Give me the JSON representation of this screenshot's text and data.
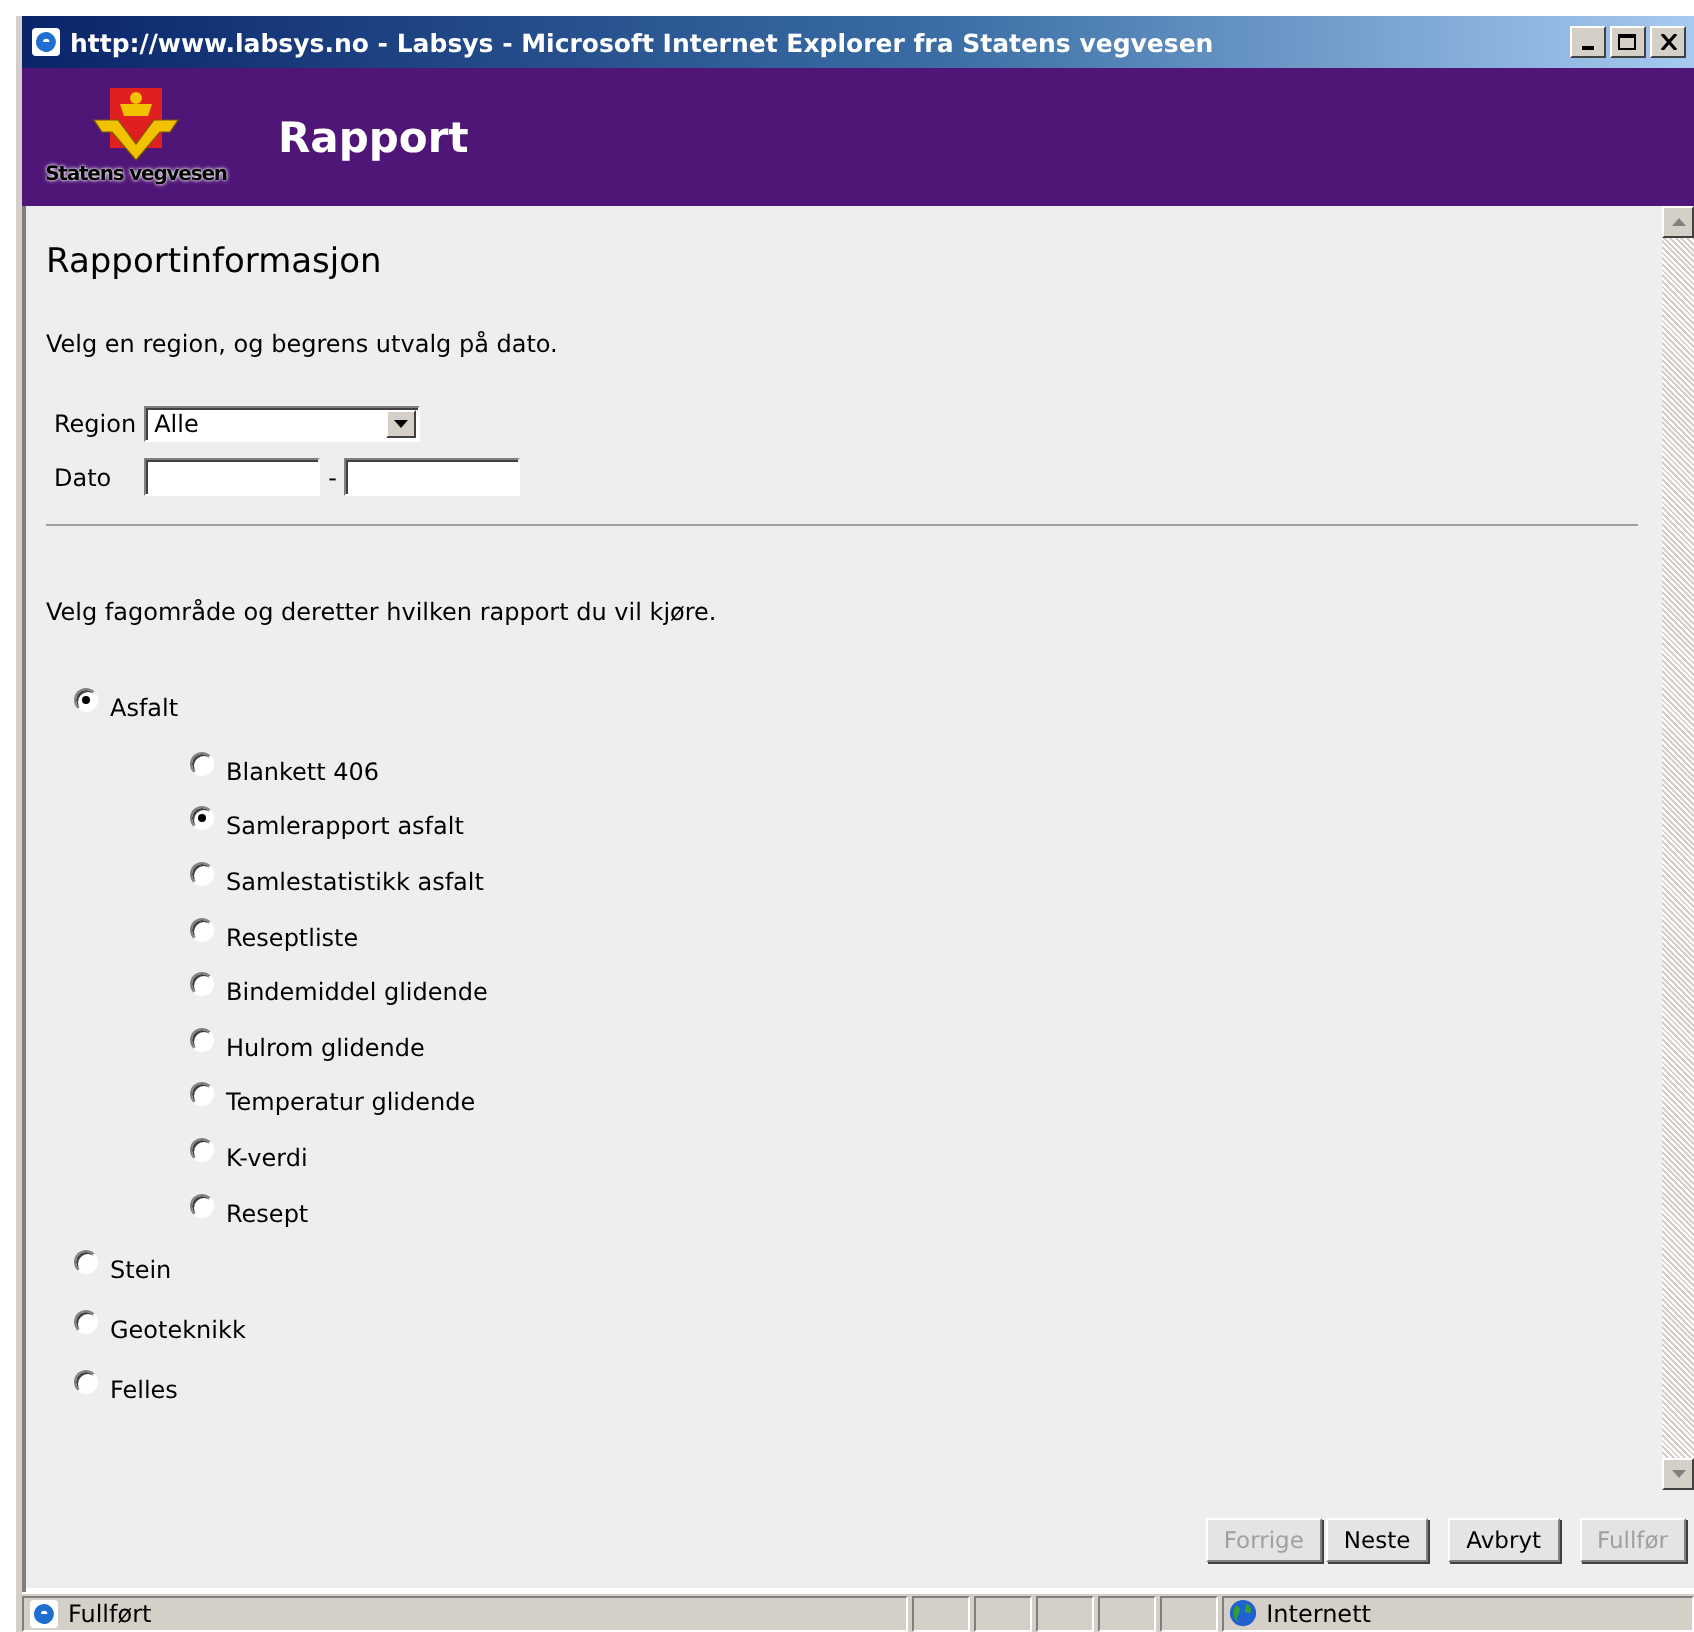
{
  "window": {
    "title": "http://www.labsys.no - Labsys - Microsoft Internet Explorer fra Statens vegvesen"
  },
  "header": {
    "logo_text": "Statens vegvesen",
    "title": "Rapport"
  },
  "form": {
    "heading": "Rapportinformasjon",
    "intro": "Velg en region, og begrens utvalg på dato.",
    "region": {
      "label": "Region",
      "value": "Alle"
    },
    "date": {
      "label": "Dato",
      "separator": "-"
    },
    "instruction": "Velg fagområde og deretter hvilken rapport du vil kjøre.",
    "areas": [
      {
        "label": "Asfalt",
        "selected": true,
        "children": [
          {
            "label": "Blankett 406",
            "selected": false
          },
          {
            "label": "Samlerapport asfalt",
            "selected": true
          },
          {
            "label": "Samlestatistikk asfalt",
            "selected": false
          },
          {
            "label": "Reseptliste",
            "selected": false
          },
          {
            "label": "Bindemiddel glidende",
            "selected": false
          },
          {
            "label": "Hulrom glidende",
            "selected": false
          },
          {
            "label": "Temperatur glidende",
            "selected": false
          },
          {
            "label": "K-verdi",
            "selected": false
          },
          {
            "label": "Resept",
            "selected": false
          }
        ]
      },
      {
        "label": "Stein",
        "selected": false
      },
      {
        "label": "Geoteknikk",
        "selected": false
      },
      {
        "label": "Felles",
        "selected": false
      }
    ]
  },
  "buttons": [
    {
      "label": "Forrige",
      "disabled": true
    },
    {
      "label": "Neste",
      "disabled": false
    },
    {
      "label": "Avbryt",
      "disabled": false
    },
    {
      "label": "Fullfør",
      "disabled": true
    }
  ],
  "status_bar": {
    "text": "Fullført",
    "zone": "Internett"
  }
}
